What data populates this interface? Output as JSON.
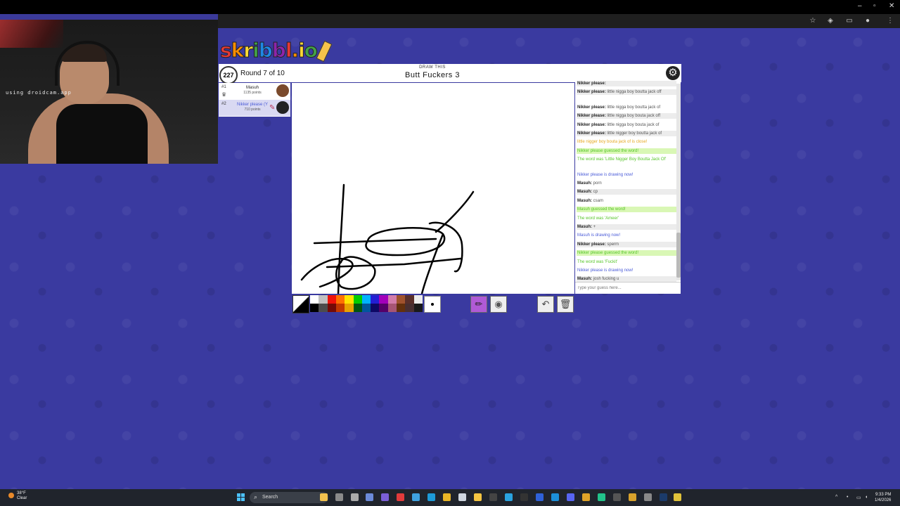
{
  "webcam": {
    "overlay_text": "using droidcam.app"
  },
  "browser": {
    "window_controls": [
      "–",
      "▫",
      "✕"
    ]
  },
  "game": {
    "logo_text": "skribbl.io",
    "timer": "227",
    "round": "Round 7 of 10",
    "draw_this_label": "DRAW THIS",
    "word": "Butt Fuckers 3",
    "players": [
      {
        "rank": "#1",
        "name": "Masuh",
        "points": "1135 points"
      },
      {
        "rank": "#2",
        "name": "Nikker please (Y",
        "points": "710 points"
      }
    ]
  },
  "chat": {
    "messages": [
      {
        "user": "Nikker please:",
        "text": "",
        "style": "alt"
      },
      {
        "user": "Nikker please:",
        "text": "little nigga boy boutta jack off",
        "style": "alt"
      },
      {
        "user": "Nikker please:",
        "text": "little nigga boy boutta jack of",
        "style": "plain"
      },
      {
        "user": "Nikker please:",
        "text": "little nigga boy bouta jack off",
        "style": "alt"
      },
      {
        "user": "Nikker please:",
        "text": "little nigga boy bouta jack of",
        "style": "plain"
      },
      {
        "user": "Nikker please:",
        "text": "little nigger boy boutta jack of",
        "style": "alt"
      },
      {
        "user": "",
        "text": "little nigger boy bouta jack of is close!",
        "style": "orange"
      },
      {
        "user": "",
        "text": "Nikker please guessed the word!",
        "style": "greenbg"
      },
      {
        "user": "",
        "text": "The word was 'Little Nigger Boy Boutta Jack Of'",
        "style": "green"
      },
      {
        "user": "",
        "text": "Nikker please is drawing now!",
        "style": "blue"
      },
      {
        "user": "Masuh:",
        "text": "porn",
        "style": "plain"
      },
      {
        "user": "Masuh:",
        "text": "cp",
        "style": "alt"
      },
      {
        "user": "Masuh:",
        "text": "csam",
        "style": "plain"
      },
      {
        "user": "",
        "text": "Masuh guessed the word!",
        "style": "greenbg"
      },
      {
        "user": "",
        "text": "The word was 'Ameer'",
        "style": "green"
      },
      {
        "user": "Masuh:",
        "text": "+",
        "style": "alt"
      },
      {
        "user": "",
        "text": "Masuh is drawing now!",
        "style": "blue"
      },
      {
        "user": "Nikker please:",
        "text": "sperm",
        "style": "alt"
      },
      {
        "user": "",
        "text": "Nikker please guessed the word!",
        "style": "greenbg"
      },
      {
        "user": "",
        "text": "The word was 'Fuckit'",
        "style": "green"
      },
      {
        "user": "",
        "text": "Nikker please is drawing now!",
        "style": "blue"
      },
      {
        "user": "Masuh:",
        "text": "josh fucking u",
        "style": "alt"
      }
    ],
    "input_placeholder": "Type your guess here..."
  },
  "toolbar": {
    "colors_top": [
      "#ffffff",
      "#c1c1c1",
      "#ef130b",
      "#ff7100",
      "#ffe400",
      "#00cc00",
      "#00b2ff",
      "#231fd3",
      "#a300ba",
      "#d37caa",
      "#a0522d",
      "#592f2a",
      "#ececec"
    ],
    "colors_bottom": [
      "#000000",
      "#4c4c4c",
      "#740b07",
      "#c23800",
      "#e8a200",
      "#005510",
      "#00569e",
      "#0e0865",
      "#550069",
      "#a75574",
      "#63300d",
      "#492f31",
      "#1a1a1a"
    ],
    "active_tool": "pen"
  },
  "taskbar": {
    "weather_temp": "38°F",
    "weather_desc": "Clear",
    "search_label": "Search",
    "time": "9:33 PM",
    "date": "1/4/2026"
  }
}
